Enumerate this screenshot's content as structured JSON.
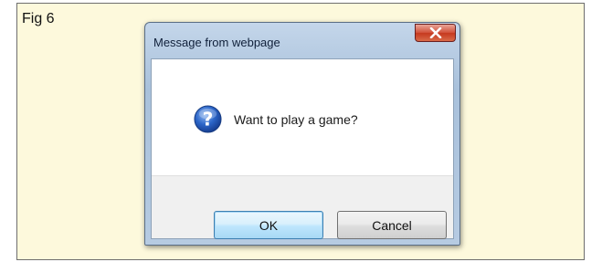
{
  "figure": {
    "label": "Fig 6"
  },
  "dialog": {
    "title": "Message from webpage",
    "close_icon": "close-icon",
    "message_icon": "question-icon",
    "message": "Want to play a game?",
    "buttons": {
      "ok": "OK",
      "cancel": "Cancel"
    }
  },
  "colors": {
    "figure_background": "#fdf9dc",
    "title_bar": "#b6cbe2",
    "close_button": "#c5391f",
    "question_icon": "#1f56b6"
  }
}
